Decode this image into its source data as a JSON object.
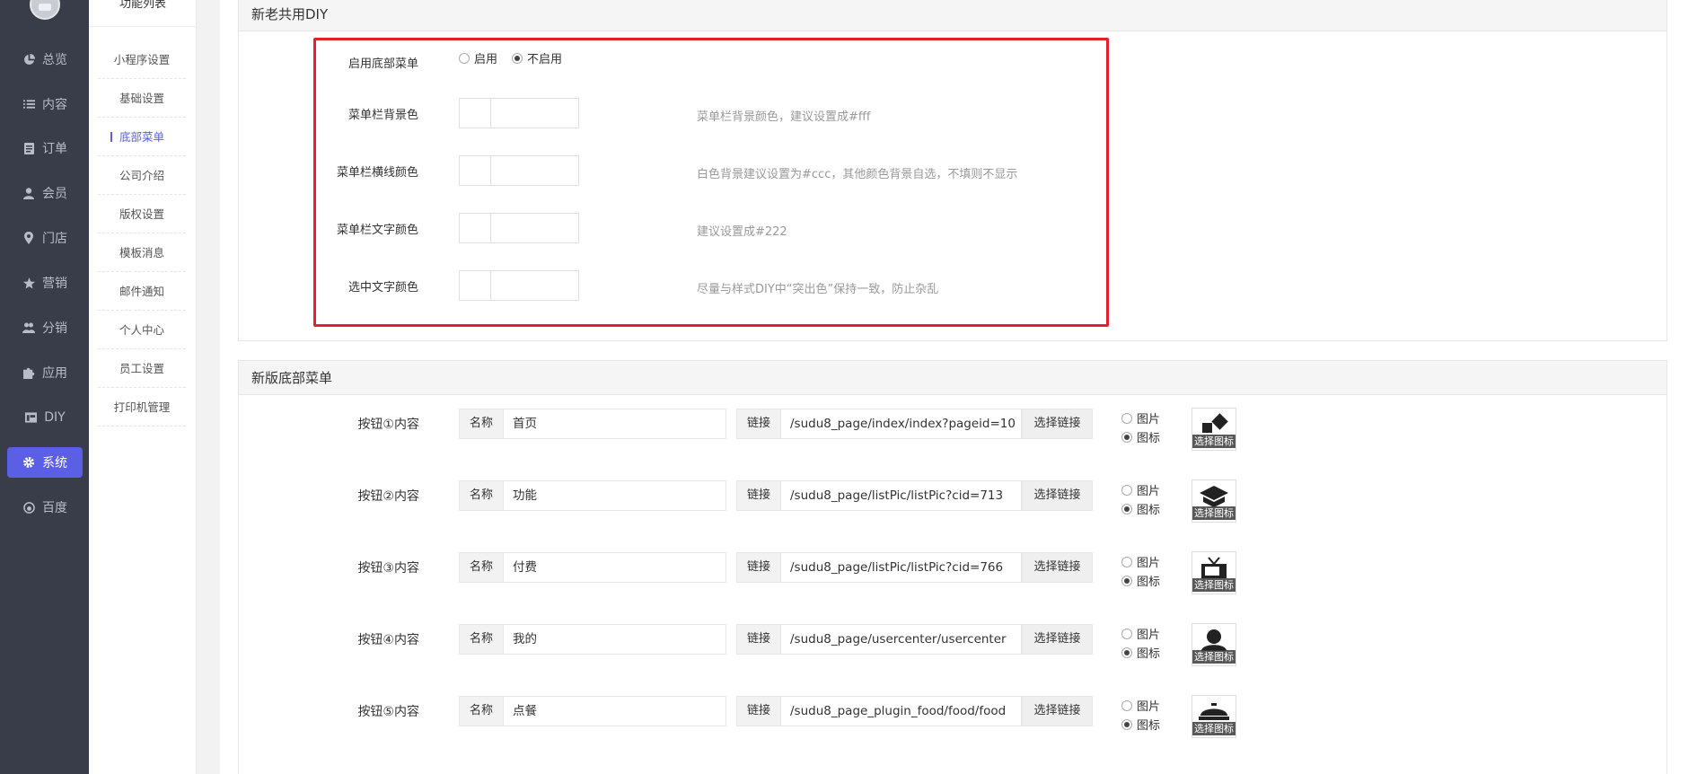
{
  "sidebar": {
    "items": [
      {
        "label": "总览",
        "icon": "pie-chart-icon"
      },
      {
        "label": "内容",
        "icon": "list-icon"
      },
      {
        "label": "订单",
        "icon": "document-icon"
      },
      {
        "label": "会员",
        "icon": "user-icon"
      },
      {
        "label": "门店",
        "icon": "map-pin-icon"
      },
      {
        "label": "营销",
        "icon": "star-icon"
      },
      {
        "label": "分销",
        "icon": "users-icon"
      },
      {
        "label": "应用",
        "icon": "puzzle-icon"
      },
      {
        "label": "DIY",
        "icon": "layout-icon"
      },
      {
        "label": "系统",
        "icon": "gear-icon",
        "active": true
      },
      {
        "label": "百度",
        "icon": "baidu-icon"
      }
    ]
  },
  "submenu": {
    "title": "功能列表",
    "items": [
      {
        "label": "小程序设置"
      },
      {
        "label": "基础设置"
      },
      {
        "label": "底部菜单",
        "active": true
      },
      {
        "label": "公司介绍"
      },
      {
        "label": "版权设置"
      },
      {
        "label": "模板消息"
      },
      {
        "label": "邮件通知"
      },
      {
        "label": "个人中心"
      },
      {
        "label": "员工设置"
      },
      {
        "label": "打印机管理"
      }
    ]
  },
  "panel1": {
    "title": "新老共用DIY",
    "enable": {
      "label": "启用底部菜单",
      "options": [
        "启用",
        "不启用"
      ],
      "selected": "不启用"
    },
    "colors": [
      {
        "label": "菜单栏背景色",
        "hint": "菜单栏背景颜色，建议设置成#fff"
      },
      {
        "label": "菜单栏横线颜色",
        "hint": "白色背景建议设置为#ccc，其他颜色背景自选，不填则不显示"
      },
      {
        "label": "菜单栏文字颜色",
        "hint": "建议设置成#222"
      },
      {
        "label": "选中文字颜色",
        "hint": "尽量与样式DIY中“突出色”保持一致，防止杂乱"
      }
    ]
  },
  "panel2": {
    "title": "新版底部菜单",
    "name_addon": "名称",
    "link_addon": "链接",
    "select_link": "选择链接",
    "type_options": [
      "图片",
      "图标"
    ],
    "icon_caption": "选择图标",
    "buttons": [
      {
        "label": "按钮①内容",
        "name": "首页",
        "link": "/sudu8_page/index/index?pageid=10",
        "type": "图标",
        "icon": "home-shapes-icon"
      },
      {
        "label": "按钮②内容",
        "name": "功能",
        "link": "/sudu8_page/listPic/listPic?cid=713",
        "type": "图标",
        "icon": "cube-stack-icon"
      },
      {
        "label": "按钮③内容",
        "name": "付费",
        "link": "/sudu8_page/listPic/listPic?cid=766",
        "type": "图标",
        "icon": "tv-icon"
      },
      {
        "label": "按钮④内容",
        "name": "我的",
        "link": "/sudu8_page/usercenter/usercenter",
        "type": "图标",
        "icon": "person-icon"
      },
      {
        "label": "按钮⑤内容",
        "name": "点餐",
        "link": "/sudu8_page_plugin_food/food/food",
        "type": "图标",
        "icon": "dish-icon"
      }
    ]
  }
}
